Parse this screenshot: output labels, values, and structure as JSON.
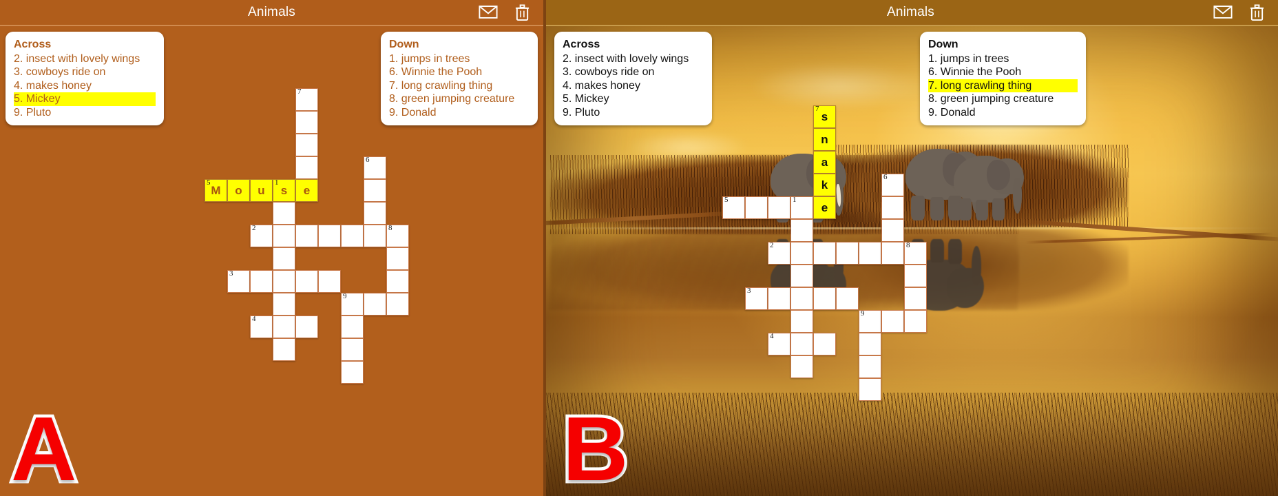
{
  "app": {
    "title": "Animals",
    "icons": {
      "mail": "envelope-icon",
      "delete": "trash-icon"
    },
    "colors": {
      "panel_a_bg": "#b25f1c",
      "header_a_bg": "#b05d1b",
      "header_b_bg": "#9b6515",
      "clue_text_a": "#b05d1b",
      "clue_text_b": "#111111",
      "highlight": "#ffff00",
      "cell_border": "#c9794a",
      "badge_fill": "#f50000",
      "badge_stroke": "#ffffff"
    }
  },
  "panels": [
    {
      "id": "A",
      "badge": "A",
      "background": "solid-brown",
      "title": "Animals",
      "across": {
        "heading": "Across",
        "items": [
          {
            "num": "2.",
            "text": "insect with lovely wings",
            "highlighted": false
          },
          {
            "num": "3.",
            "text": "cowboys ride on",
            "highlighted": false
          },
          {
            "num": "4.",
            "text": "makes honey",
            "highlighted": false
          },
          {
            "num": "5.",
            "text": "Mickey",
            "highlighted": true
          },
          {
            "num": "9.",
            "text": "Pluto",
            "highlighted": false
          }
        ]
      },
      "down": {
        "heading": "Down",
        "items": [
          {
            "num": "1.",
            "text": "jumps in trees",
            "highlighted": false
          },
          {
            "num": "6.",
            "text": "Winnie the Pooh",
            "highlighted": false
          },
          {
            "num": "7.",
            "text": "long crawling thing",
            "highlighted": false
          },
          {
            "num": "8.",
            "text": "green jumping creature",
            "highlighted": false
          },
          {
            "num": "9.",
            "text": "Donald",
            "highlighted": false
          }
        ]
      },
      "answer_entered": {
        "word": "Mouse",
        "clue": "5 Across",
        "orientation": "across"
      }
    },
    {
      "id": "B",
      "badge": "B",
      "background": "savanna-elephants-photo",
      "title": "Animals",
      "across": {
        "heading": "Across",
        "items": [
          {
            "num": "2.",
            "text": "insect with lovely wings",
            "highlighted": false
          },
          {
            "num": "3.",
            "text": "cowboys ride on",
            "highlighted": false
          },
          {
            "num": "4.",
            "text": "makes honey",
            "highlighted": false
          },
          {
            "num": "5.",
            "text": "Mickey",
            "highlighted": false
          },
          {
            "num": "9.",
            "text": "Pluto",
            "highlighted": false
          }
        ]
      },
      "down": {
        "heading": "Down",
        "items": [
          {
            "num": "1.",
            "text": "jumps in trees",
            "highlighted": false
          },
          {
            "num": "6.",
            "text": "Winnie the Pooh",
            "highlighted": false
          },
          {
            "num": "7.",
            "text": "long crawling thing",
            "highlighted": true
          },
          {
            "num": "8.",
            "text": "green jumping creature",
            "highlighted": false
          },
          {
            "num": "9.",
            "text": "Donald",
            "highlighted": false
          }
        ]
      },
      "answer_entered": {
        "word": "snake",
        "clue": "7 Down",
        "orientation": "down"
      }
    }
  ],
  "grid": {
    "cols": 12,
    "rows": 13,
    "cells_a": [
      {
        "c": 6,
        "r": 0,
        "num": "7"
      },
      {
        "c": 6,
        "r": 1
      },
      {
        "c": 6,
        "r": 2
      },
      {
        "c": 6,
        "r": 3
      },
      {
        "c": 9,
        "r": 3,
        "num": "6"
      },
      {
        "c": 2,
        "r": 4,
        "num": "5",
        "letter": "M",
        "filled": true
      },
      {
        "c": 3,
        "r": 4,
        "letter": "o",
        "filled": true
      },
      {
        "c": 4,
        "r": 4,
        "letter": "u",
        "filled": true
      },
      {
        "c": 5,
        "r": 4,
        "num": "1",
        "letter": "s",
        "filled": true
      },
      {
        "c": 6,
        "r": 4,
        "letter": "e",
        "filled": true
      },
      {
        "c": 9,
        "r": 4
      },
      {
        "c": 5,
        "r": 5
      },
      {
        "c": 9,
        "r": 5
      },
      {
        "c": 4,
        "r": 6,
        "num": "2"
      },
      {
        "c": 5,
        "r": 6
      },
      {
        "c": 6,
        "r": 6
      },
      {
        "c": 7,
        "r": 6
      },
      {
        "c": 8,
        "r": 6
      },
      {
        "c": 9,
        "r": 6
      },
      {
        "c": 10,
        "r": 6,
        "num": "8"
      },
      {
        "c": 5,
        "r": 7
      },
      {
        "c": 10,
        "r": 7
      },
      {
        "c": 3,
        "r": 8,
        "num": "3"
      },
      {
        "c": 4,
        "r": 8
      },
      {
        "c": 5,
        "r": 8
      },
      {
        "c": 6,
        "r": 8
      },
      {
        "c": 7,
        "r": 8
      },
      {
        "c": 10,
        "r": 8
      },
      {
        "c": 5,
        "r": 9
      },
      {
        "c": 8,
        "r": 9,
        "num": "9"
      },
      {
        "c": 9,
        "r": 9
      },
      {
        "c": 10,
        "r": 9
      },
      {
        "c": 4,
        "r": 10,
        "num": "4"
      },
      {
        "c": 5,
        "r": 10
      },
      {
        "c": 6,
        "r": 10
      },
      {
        "c": 8,
        "r": 10
      },
      {
        "c": 5,
        "r": 11
      },
      {
        "c": 8,
        "r": 11
      },
      {
        "c": 8,
        "r": 12
      }
    ],
    "cells_b": [
      {
        "c": 6,
        "r": 0,
        "num": "7",
        "letter": "s",
        "filled": true
      },
      {
        "c": 6,
        "r": 1,
        "letter": "n",
        "filled": true
      },
      {
        "c": 6,
        "r": 2,
        "letter": "a",
        "filled": true
      },
      {
        "c": 6,
        "r": 3,
        "letter": "k",
        "filled": true
      },
      {
        "c": 9,
        "r": 3,
        "num": "6"
      },
      {
        "c": 2,
        "r": 4,
        "num": "5"
      },
      {
        "c": 3,
        "r": 4
      },
      {
        "c": 4,
        "r": 4
      },
      {
        "c": 5,
        "r": 4,
        "num": "1"
      },
      {
        "c": 6,
        "r": 4,
        "letter": "e",
        "filled": true
      },
      {
        "c": 9,
        "r": 4
      },
      {
        "c": 5,
        "r": 5
      },
      {
        "c": 9,
        "r": 5
      },
      {
        "c": 4,
        "r": 6,
        "num": "2"
      },
      {
        "c": 5,
        "r": 6
      },
      {
        "c": 6,
        "r": 6
      },
      {
        "c": 7,
        "r": 6
      },
      {
        "c": 8,
        "r": 6
      },
      {
        "c": 9,
        "r": 6
      },
      {
        "c": 10,
        "r": 6,
        "num": "8"
      },
      {
        "c": 5,
        "r": 7
      },
      {
        "c": 10,
        "r": 7
      },
      {
        "c": 3,
        "r": 8,
        "num": "3"
      },
      {
        "c": 4,
        "r": 8
      },
      {
        "c": 5,
        "r": 8
      },
      {
        "c": 6,
        "r": 8
      },
      {
        "c": 7,
        "r": 8
      },
      {
        "c": 10,
        "r": 8
      },
      {
        "c": 5,
        "r": 9
      },
      {
        "c": 8,
        "r": 9,
        "num": "9"
      },
      {
        "c": 9,
        "r": 9
      },
      {
        "c": 10,
        "r": 9
      },
      {
        "c": 4,
        "r": 10,
        "num": "4"
      },
      {
        "c": 5,
        "r": 10
      },
      {
        "c": 6,
        "r": 10
      },
      {
        "c": 8,
        "r": 10
      },
      {
        "c": 5,
        "r": 11
      },
      {
        "c": 8,
        "r": 11
      },
      {
        "c": 8,
        "r": 12
      }
    ]
  }
}
